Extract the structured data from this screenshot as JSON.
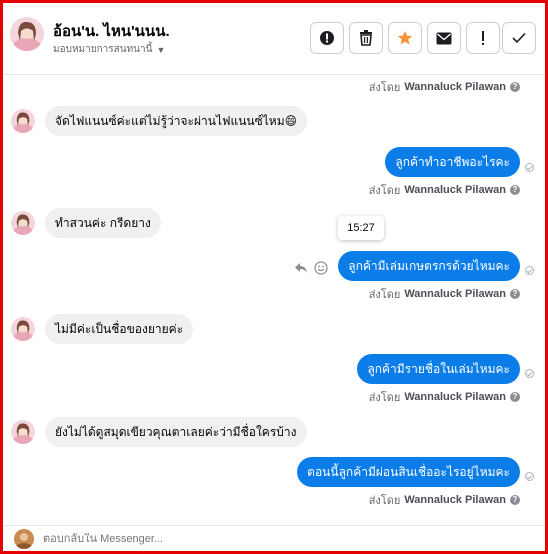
{
  "header": {
    "contact_name": "อ้อน'น. ไหน'นนน.",
    "assign_label": "มอบหมายการสนทนานี้",
    "buttons": [
      {
        "name": "info-button",
        "icon": "info-icon"
      },
      {
        "name": "delete-button",
        "icon": "trash-icon"
      },
      {
        "name": "star-button",
        "icon": "star-icon"
      },
      {
        "name": "mark-unread-button",
        "icon": "envelope-icon"
      },
      {
        "name": "spam-button",
        "icon": "exclamation-icon"
      },
      {
        "name": "mark-done-button",
        "icon": "check-icon"
      }
    ]
  },
  "thread": {
    "sent_by_prefix": "ส่งโดย",
    "sender_name": "Wannaluck Pilawan",
    "tooltip_time": "15:27",
    "messages": [
      {
        "dir": "out-footer"
      },
      {
        "dir": "in",
        "text": "จัดไฟแนนซ์ค่ะแต่ไม่รู้ว่าจะผ่านไฟแนนซ์ไหม😄"
      },
      {
        "dir": "out",
        "text": "ลูกค้าทำอาชีพอะไรคะ"
      },
      {
        "dir": "in",
        "text": "ทำสวนค่ะ กรีดยาง"
      },
      {
        "dir": "out",
        "text": "ลูกค้ามีเล่มเกษตรกรด้วยไหมคะ"
      },
      {
        "dir": "in",
        "text": "ไม่มีค่ะเป็นชื่อของยายค่ะ"
      },
      {
        "dir": "out",
        "text": "ลูกค้ามีรายชื่อในเล่มไหมคะ"
      },
      {
        "dir": "in",
        "text": "ยังไม่ได้ดูสมุดเขียวคุณตาเลยค่ะว่ามีชื่อใครบ้าง"
      },
      {
        "dir": "out",
        "text": "ตอนนี้ลูกค้ามีผ่อนสินเชื่ออะไรอยู่ไหมคะ"
      }
    ]
  },
  "composer": {
    "placeholder": "ตอบกลับใน Messenger..."
  },
  "colors": {
    "accent": "#0b7de8",
    "incoming_bubble": "#f0f0f0",
    "frame": "#e60000",
    "star": "#f7923b"
  }
}
